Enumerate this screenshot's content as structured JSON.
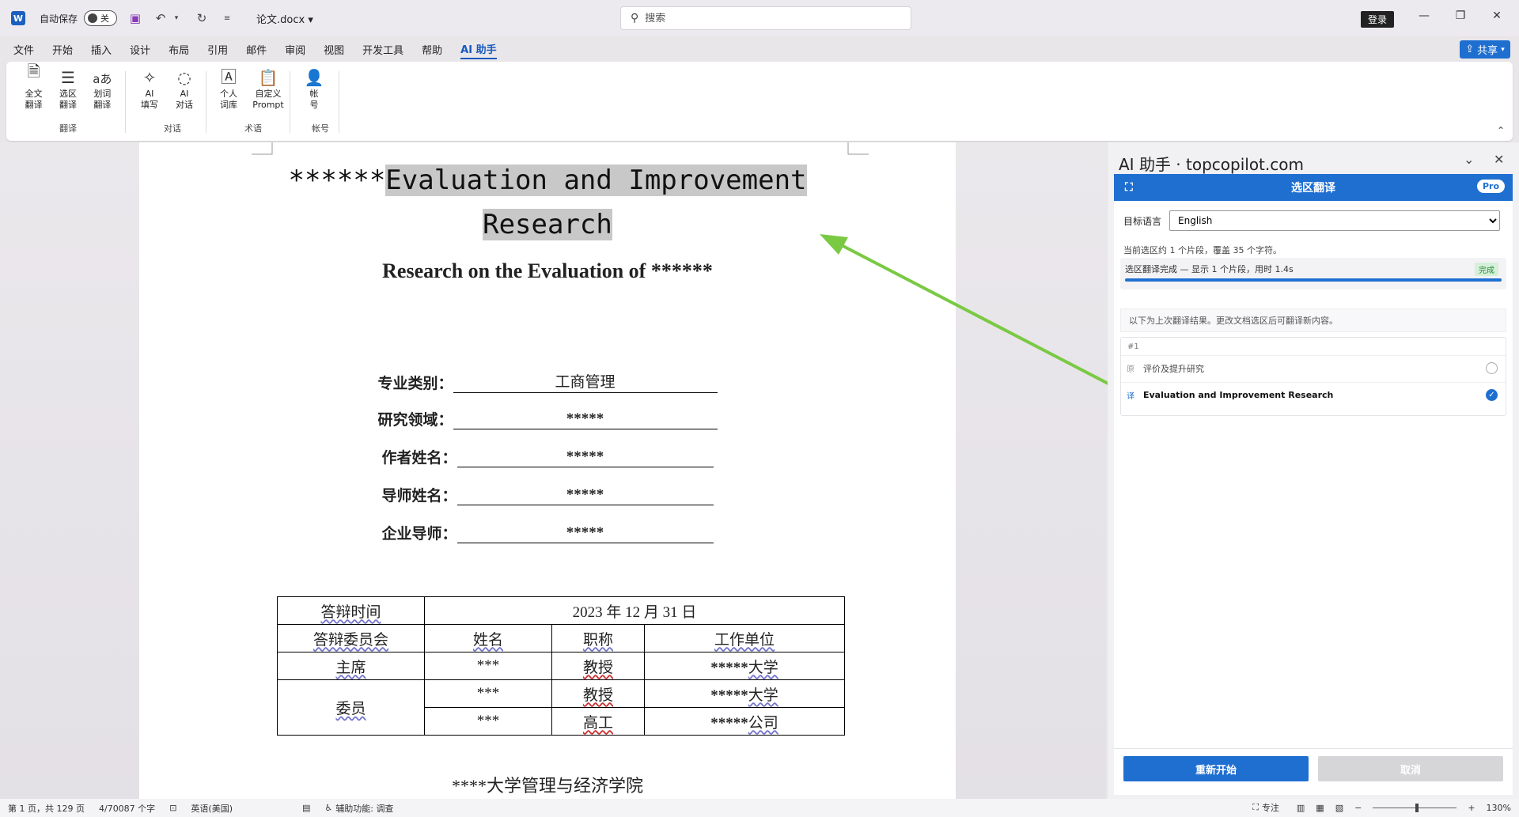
{
  "titlebar": {
    "autosave_label": "自动保存",
    "toggle_state": "关",
    "doc_name": "论文.docx",
    "search_placeholder": "搜索",
    "login_label": "登录",
    "word_logo": "W"
  },
  "menu": {
    "items": [
      "文件",
      "开始",
      "插入",
      "设计",
      "布局",
      "引用",
      "邮件",
      "审阅",
      "视图",
      "开发工具",
      "帮助",
      "AI 助手"
    ],
    "active_index": 11,
    "share_label": "共享"
  },
  "ribbon": {
    "groups": [
      {
        "name": "翻译",
        "buttons": [
          {
            "label": "全文\n翻译",
            "icon": "document-translate-icon"
          },
          {
            "label": "选区\n翻译",
            "icon": "selection-translate-icon"
          },
          {
            "label": "划词\n翻译",
            "icon": "word-translate-icon"
          }
        ]
      },
      {
        "name": "对话",
        "buttons": [
          {
            "label": "AI\n填写",
            "icon": "ai-write-icon"
          },
          {
            "label": "AI\n对话",
            "icon": "ai-chat-icon"
          }
        ]
      },
      {
        "name": "术语",
        "buttons": [
          {
            "label": "个人\n词库",
            "icon": "glossary-icon"
          },
          {
            "label": "自定义\nPrompt",
            "icon": "prompt-icon"
          }
        ]
      },
      {
        "name": "帐号",
        "buttons": [
          {
            "label": "帐\n号",
            "icon": "account-icon"
          }
        ]
      }
    ]
  },
  "document": {
    "title_prefix": "******",
    "title_selected_line1": "Evaluation and Improvement ",
    "title_selected_line2": "Research",
    "subtitle": "Research on the Evaluation of ******",
    "info_rows": [
      {
        "label": "专业类别：",
        "value": "工商管理"
      },
      {
        "label": "研究领域：",
        "value": "*****"
      },
      {
        "label": "作者姓名：",
        "value": "*****"
      },
      {
        "label": "导师姓名：",
        "value": "*****"
      },
      {
        "label": "企业导师：",
        "value": "*****"
      }
    ],
    "table": {
      "defense_time_label": "答辩时间",
      "defense_time_value": "2023 年 12 月 31 日",
      "committee_label": "答辩委员会",
      "headers": [
        "姓名",
        "职称",
        "工作单位"
      ],
      "chair_label": "主席",
      "member_label": "委员",
      "rows": [
        {
          "name": "***",
          "title": "教授",
          "org_mask": "*****",
          "org_suffix": "大学"
        },
        {
          "name": "***",
          "title": "教授",
          "org_mask": "*****",
          "org_suffix": "大学"
        },
        {
          "name": "***",
          "title": "高工",
          "org_mask": "*****",
          "org_suffix": "公司"
        }
      ]
    },
    "college": "****大学管理与经济学院"
  },
  "pane": {
    "header": "AI 助手 · topcopilot.com",
    "mode_title": "选区翻译",
    "pro_badge": "Pro",
    "target_language_label": "目标语言",
    "target_language": "English",
    "selection_info": "当前选区约 1 个片段，覆盖 35 个字符。",
    "progress_text": "选区翻译完成 — 显示 1 个片段，用时 1.4s",
    "done_badge": "完成",
    "progress": 1.0,
    "note": "以下为上次翻译结果。更改文档选区后可翻译新内容。",
    "result": {
      "index": "#1",
      "source_tag": "原",
      "source_text": "评价及提升研究",
      "target_tag": "译",
      "target_text": "Evaluation and Improvement Research",
      "selected": "target"
    },
    "restart_label": "重新开始",
    "cancel_label": "取消"
  },
  "statusbar": {
    "page_info": "第 1 页，共 129 页",
    "word_count": "4/70087 个字",
    "language": "英语(美国)",
    "accessibility": "辅助功能: 调查",
    "focus_label": "专注",
    "zoom": "130%"
  },
  "colors": {
    "accent": "#1f6fd1",
    "arrow": "#7ac943",
    "selection": "#c8c8c8"
  }
}
